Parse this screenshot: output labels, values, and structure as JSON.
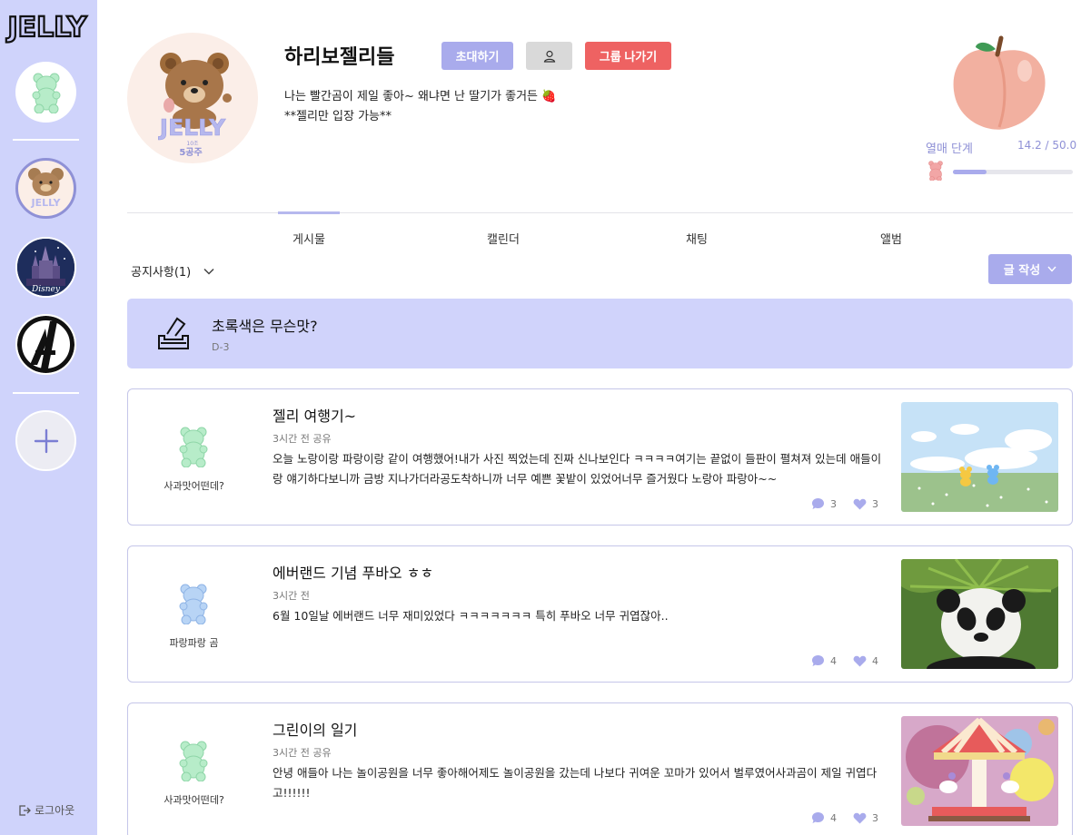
{
  "sidebar": {
    "logo_text": "JELLY",
    "logout_label": "로그아웃"
  },
  "group": {
    "name": "하리보젤리들",
    "avatar_logo": "JELLY",
    "avatar_caption": "5공주",
    "avatar_caption_small": "10조",
    "invite_label": "초대하기",
    "leave_label": "그룹 나가기",
    "description_line1": "나는 빨간곰이 제일 좋아~ 왜냐면 난 딸기가 좋거든 🍓",
    "description_line2": "**젤리만 입장 가능**"
  },
  "level": {
    "label": "열매 단계",
    "value_text": "14.2 / 50.0",
    "current": 14.2,
    "max": 50.0
  },
  "tabs": [
    {
      "label": "게시물",
      "active": true
    },
    {
      "label": "캘린더",
      "active": false
    },
    {
      "label": "채팅",
      "active": false
    },
    {
      "label": "앨범",
      "active": false
    }
  ],
  "notice_toggle": {
    "label": "공지사항(1)"
  },
  "write_button": {
    "label": "글 작성"
  },
  "notice": {
    "title": "초록색은 무슨맛?",
    "sub": "D-3"
  },
  "posts": [
    {
      "author": "사과맛어떤데?",
      "author_color": "#b7ecc9",
      "title": "젤리 여행기~",
      "meta": "3시간 전 공유",
      "body": "오늘 노랑이랑 파랑이랑 같이 여행했어!내가 사진 찍었는데 진짜 신나보인다 ㅋㅋㅋㅋ여기는 끝없이 들판이 펼쳐져 있는데 애들이랑 얘기하다보니까 금방 지나가더라공도착하니까 너무 예쁜 꽃밭이 있었어너무 즐거웠다 노랑아 파랑아~~",
      "comments": "3",
      "likes": "3"
    },
    {
      "author": "파랑파랑 곰",
      "author_color": "#b8d4f5",
      "title": "에버랜드 기념 푸바오 ㅎㅎ",
      "meta": "3시간 전",
      "body": "6월 10일날 에버랜드 너무 재미있었다 ㅋㅋㅋㅋㅋㅋㅋ 특히 푸바오 너무 귀엽잖아..",
      "comments": "4",
      "likes": "4"
    },
    {
      "author": "사과맛어떤데?",
      "author_color": "#b7ecc9",
      "title": "그린이의 일기",
      "meta": "3시간 전 공유",
      "body": "안녕 애들아 나는 놀이공원을 너무 좋아해어제도 놀이공원을 갔는데 나보다 귀여운 꼬마가 있어서 벌루였어사과곰이 제일 귀엽다고!!!!!!",
      "comments": "4",
      "likes": "3"
    }
  ],
  "colors": {
    "sidebar_bg": "#cfd3fb",
    "accent": "#a9abec",
    "danger": "#ee6262",
    "notice_bg": "#d0d3fb"
  }
}
